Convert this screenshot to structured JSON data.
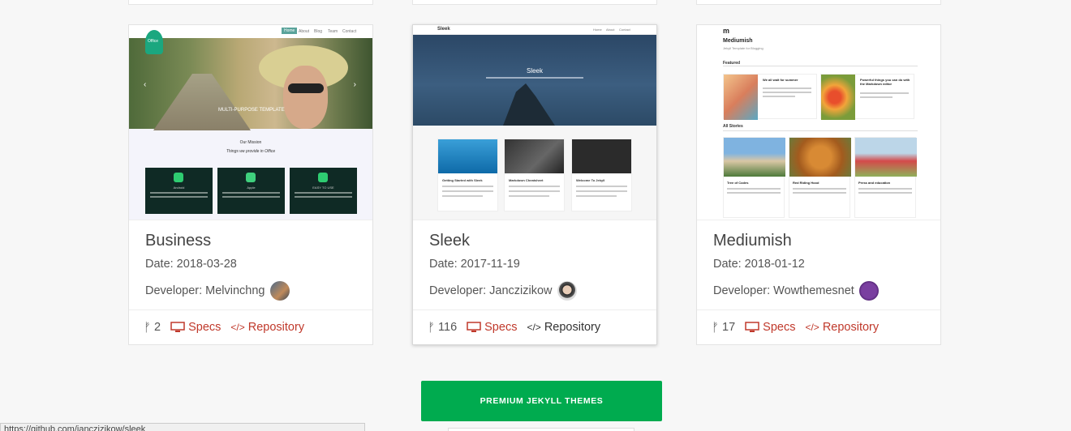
{
  "cards": [
    {
      "title": "Business",
      "date": "Date: 2018-03-28",
      "developer": "Developer: Melvinchng",
      "forks": "2",
      "specs": "Specs",
      "repository": "Repository",
      "preview": {
        "nav": [
          "Home",
          "About",
          "Blog",
          "Team",
          "Contact"
        ],
        "hero_text": "MULTI-PURPOSE TEMPLATE",
        "badge": "Office",
        "mission": "Our Mission",
        "mission_sub": "Things we provide in Office",
        "boxes": [
          "Android",
          "Apple",
          "EASY TO USE"
        ]
      }
    },
    {
      "title": "Sleek",
      "date": "Date: 2017-11-19",
      "developer": "Developer: Janczizikow",
      "forks": "116",
      "specs": "Specs",
      "repository": "Repository",
      "preview": {
        "brand": "Sleek",
        "nav": [
          "Home",
          "About",
          "Contact"
        ],
        "hero_title": "Sleek",
        "posts": [
          "Getting Started with Sleek",
          "Markdown Cheatsheet",
          "Welcome To Jekyll"
        ]
      }
    },
    {
      "title": "Mediumish",
      "date": "Date: 2018-01-12",
      "developer": "Developer: Wowthemesnet",
      "forks": "17",
      "specs": "Specs",
      "repository": "Repository",
      "preview": {
        "brand": "Mediumish",
        "tagline": "Jekyll Template for Blogging",
        "featured": "Featured",
        "all_stories": "All Stories",
        "featured_posts": [
          "We all wait for summer",
          "Powerful things you can do with the Markdown editor"
        ],
        "stories": [
          "Tree of Codes",
          "Red Riding Hood",
          "Press and education"
        ]
      }
    }
  ],
  "premium_button": "PREMIUM JEKYLL THEMES",
  "status_url": "https://github.com/janczizikow/sleek",
  "colors": {
    "accent_red": "#c0392b",
    "premium_green": "#00ab4f"
  }
}
